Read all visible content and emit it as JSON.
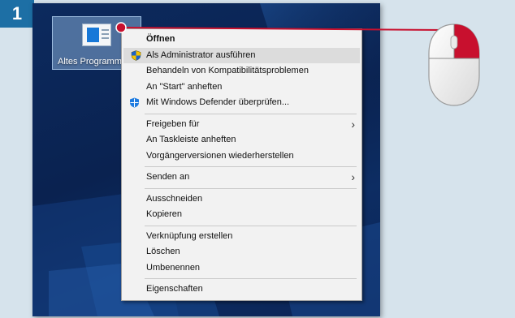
{
  "step": {
    "number": "1"
  },
  "desktop": {
    "icon_label": "Altes Programm"
  },
  "context_menu": {
    "items": [
      {
        "label": "Öffnen",
        "bold": true
      },
      {
        "label": "Als Administrator ausführen",
        "icon": "uac-shield-icon",
        "highlighted": true
      },
      {
        "label": "Behandeln von Kompatibilitätsproblemen"
      },
      {
        "label": "An \"Start\" anheften"
      },
      {
        "label": "Mit Windows Defender überprüfen...",
        "icon": "windows-defender-icon"
      },
      {
        "separator": true
      },
      {
        "label": "Freigeben für",
        "submenu": true
      },
      {
        "label": "An Taskleiste anheften"
      },
      {
        "label": "Vorgängerversionen wiederherstellen"
      },
      {
        "separator": true
      },
      {
        "label": "Senden an",
        "submenu": true
      },
      {
        "separator": true
      },
      {
        "label": "Ausschneiden"
      },
      {
        "label": "Kopieren"
      },
      {
        "separator": true
      },
      {
        "label": "Verknüpfung erstellen"
      },
      {
        "label": "Löschen"
      },
      {
        "label": "Umbenennen"
      },
      {
        "separator": true
      },
      {
        "label": "Eigenschaften"
      }
    ]
  },
  "colors": {
    "badge": "#1d6fa5",
    "pointer": "#c8102e",
    "menu_background": "#f2f2f2",
    "highlight": "#dcdcdc"
  },
  "mouse": {
    "pressed_button": "right"
  }
}
